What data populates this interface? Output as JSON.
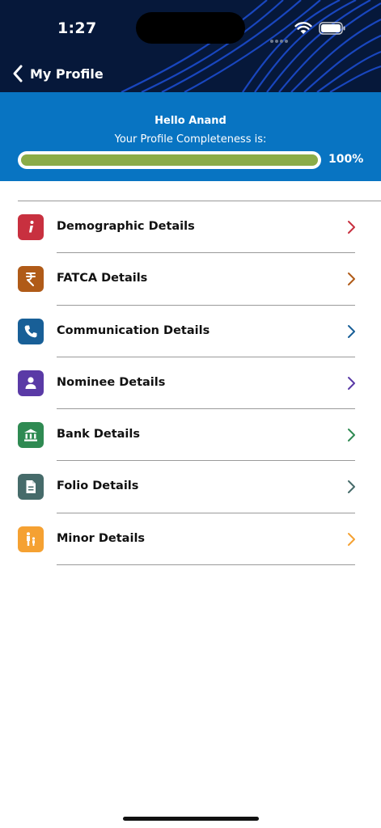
{
  "status_bar": {
    "time": "1:27"
  },
  "header": {
    "back_label": "My Profile"
  },
  "hero": {
    "greeting": "Hello Anand",
    "subtitle": "Your Profile Completeness is:",
    "progress_percent": 100,
    "progress_label": "100%",
    "progress_color": "#8aac48"
  },
  "menu": {
    "items": [
      {
        "label": "Demographic Details",
        "icon": "info-icon",
        "color": "#c8303f"
      },
      {
        "label": "FATCA Details",
        "icon": "rupee-icon",
        "color": "#b05b18"
      },
      {
        "label": "Communication Details",
        "icon": "phone-icon",
        "color": "#185f97"
      },
      {
        "label": "Nominee Details",
        "icon": "person-icon",
        "color": "#5a3aa6"
      },
      {
        "label": "Bank Details",
        "icon": "bank-icon",
        "color": "#2f8a52"
      },
      {
        "label": "Folio Details",
        "icon": "document-icon",
        "color": "#466b6a"
      },
      {
        "label": "Minor Details",
        "icon": "parent-child-icon",
        "color": "#f5a132"
      }
    ]
  }
}
